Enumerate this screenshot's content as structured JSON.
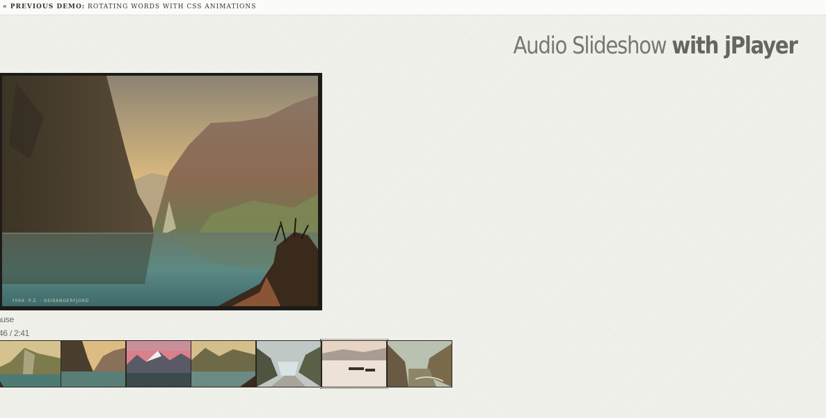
{
  "topbar": {
    "prev_label": "« Previous Demo:",
    "prev_title": "Rotating Words with CSS Animations"
  },
  "header": {
    "title_light": "Audio Slideshow",
    "title_bold": "with jPlayer"
  },
  "slide": {
    "caption": "7069. P.Z. · GEIRANGERFJORD"
  },
  "player": {
    "button_label": "ause",
    "time_display": ":46 / 2:41"
  },
  "thumbnails": [
    {
      "name": "thumb-1"
    },
    {
      "name": "thumb-2"
    },
    {
      "name": "thumb-3"
    },
    {
      "name": "thumb-4"
    },
    {
      "name": "thumb-5"
    },
    {
      "name": "thumb-6",
      "active": true
    },
    {
      "name": "thumb-7"
    }
  ]
}
